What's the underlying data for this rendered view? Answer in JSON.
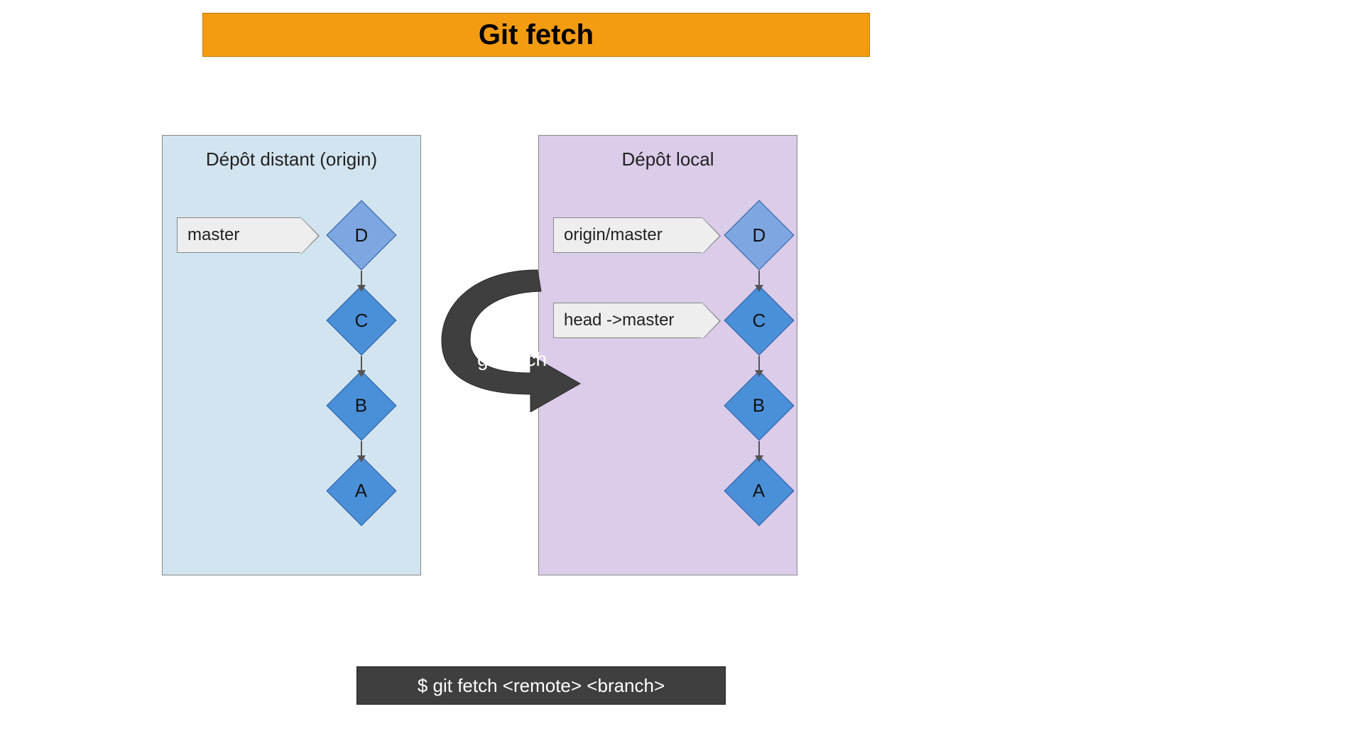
{
  "title": "Git fetch",
  "remote": {
    "heading": "Dépôt distant (origin)",
    "pointer1": "master",
    "commits": [
      "D",
      "C",
      "B",
      "A"
    ]
  },
  "local": {
    "heading": "Dépôt local",
    "pointer1": "origin/master",
    "pointer2": "head ->master",
    "commits": [
      "D",
      "C",
      "B",
      "A"
    ]
  },
  "arrow_label": "git fetch",
  "command": "$ git fetch <remote> <branch>",
  "colors": {
    "title_bg": "#f39c12",
    "remote_bg": "#d2e4ef",
    "local_bg": "#dbccea",
    "commit_light": "#7ea6e0",
    "commit_dark": "#4a90d9",
    "arrow_fill": "#3f3f3f",
    "command_bg": "#3f3f3f"
  }
}
